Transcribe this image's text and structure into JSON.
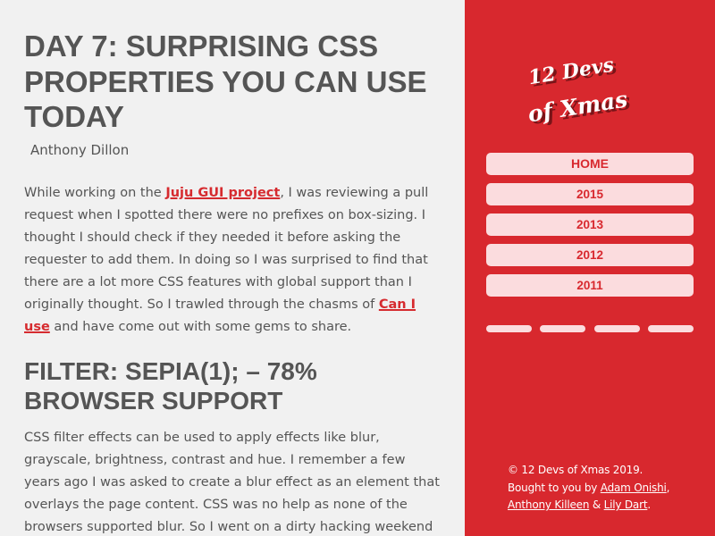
{
  "article": {
    "title": "Day 7: Surprising CSS properties you can use today",
    "author": "Anthony Dillon",
    "intro": {
      "text_1": "While working on the ",
      "link_1": "Juju GUI project",
      "text_2": ", I was reviewing a pull request when I spotted there were no prefixes on box-sizing. I thought I should check if they needed it before asking the requester to add them. In doing so I was surprised to find that there are a lot more CSS features with global support than I originally thought. So I trawled through the chasms of ",
      "link_2": "Can I use",
      "text_3": " and have come out with some gems to share."
    },
    "section_heading": "filter: sepia(1); – 78% browser support",
    "section_para": "CSS filter effects can be used to apply effects like blur, grayscale, brightness, contrast and hue. I remember a few years ago I was asked to create a blur effect as an element that overlays the page content. CSS was no help as none of the browsers supported blur. So I went on a dirty hacking weekend where I set the text to"
  },
  "sidebar": {
    "logo_line_1": "12 Devs",
    "logo_line_2": "of Xmas",
    "nav": [
      {
        "label": "HOME"
      },
      {
        "label": "2015"
      },
      {
        "label": "2013"
      },
      {
        "label": "2012"
      },
      {
        "label": "2011"
      }
    ],
    "footer": {
      "copyright": "© 12 Devs of Xmas 2019.",
      "brought_by": "Bought to you by ",
      "author_1": "Adam Onishi",
      "sep_1": ", ",
      "author_2": "Anthony Killeen",
      "sep_2": " & ",
      "author_3": "Lily Dart",
      "end": "."
    }
  },
  "colors": {
    "background": "#f1f1f1",
    "text": "#555555",
    "accent_red": "#d8282e",
    "nav_pill": "#fbdcde",
    "link": "#d62b2f"
  }
}
